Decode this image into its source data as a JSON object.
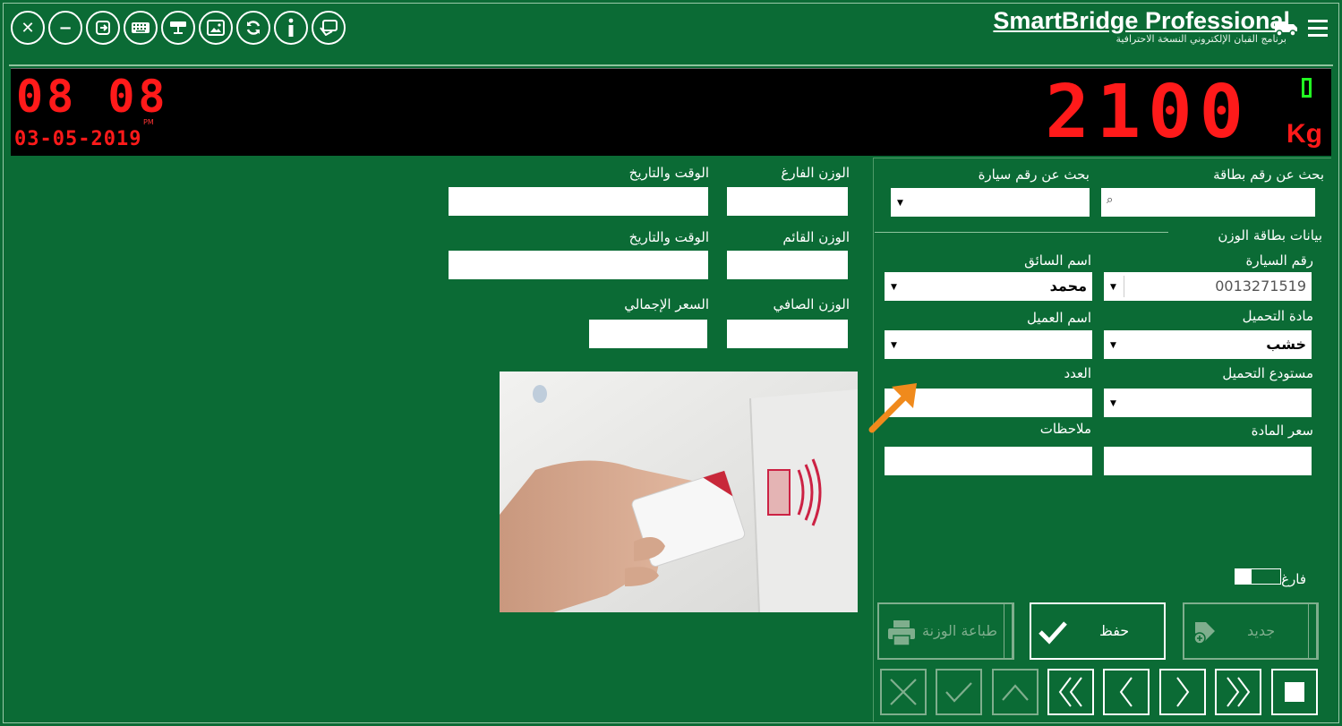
{
  "header": {
    "app_title": "SmartBridge Professional",
    "app_subtitle": "برنامج القبان الإلكتروني النسخة الاحترافية",
    "toolbar_icons": [
      "close-icon",
      "minimize-icon",
      "exit-icon",
      "keyboard-icon",
      "camera-icon",
      "image-icon",
      "refresh-icon",
      "info-icon",
      "card-icon"
    ]
  },
  "display": {
    "clock_hours": "08",
    "clock_minutes": "08",
    "ampm": "PM",
    "date": "03-05-2019",
    "weight": "2100",
    "unit": "Kg"
  },
  "search": {
    "card_label": "بحث عن رقم بطاقة",
    "vehicle_label": "بحث عن رقم سيارة",
    "card_value": "",
    "vehicle_value": ""
  },
  "form": {
    "section_title": "بيانات بطاقة الوزن",
    "vehicle_no_label": "رقم السيارة",
    "vehicle_no_value": "0013271519",
    "driver_label": "اسم السائق",
    "driver_value": "محمد",
    "material_label": "مادة التحميل",
    "material_value": "خشب",
    "customer_label": "اسم العميل",
    "customer_value": "",
    "warehouse_label": "مستودع التحميل",
    "warehouse_value": "",
    "count_label": "العدد",
    "count_value": "",
    "price_label": "سعر المادة",
    "price_value": "",
    "notes_label": "ملاحظات",
    "notes_value": "",
    "empty_toggle_label": "فارغ",
    "empty_toggle_on": false
  },
  "weights": {
    "empty_weight_label": "الوزن الفارغ",
    "empty_time_label": "الوقت والتاريخ",
    "loaded_weight_label": "الوزن القائم",
    "loaded_time_label": "الوقت والتاريخ",
    "net_weight_label": "الوزن الصافي",
    "total_price_label": "السعر الإجمالي"
  },
  "actions": {
    "print_label": "طباعة الوزنة",
    "save_label": "حفظ",
    "new_label": "جديد"
  },
  "colors": {
    "background": "#0b6b35",
    "segment_red": "#ff1a1a",
    "stable_green": "#22ff22",
    "arrow_orange": "#f08a1c"
  }
}
